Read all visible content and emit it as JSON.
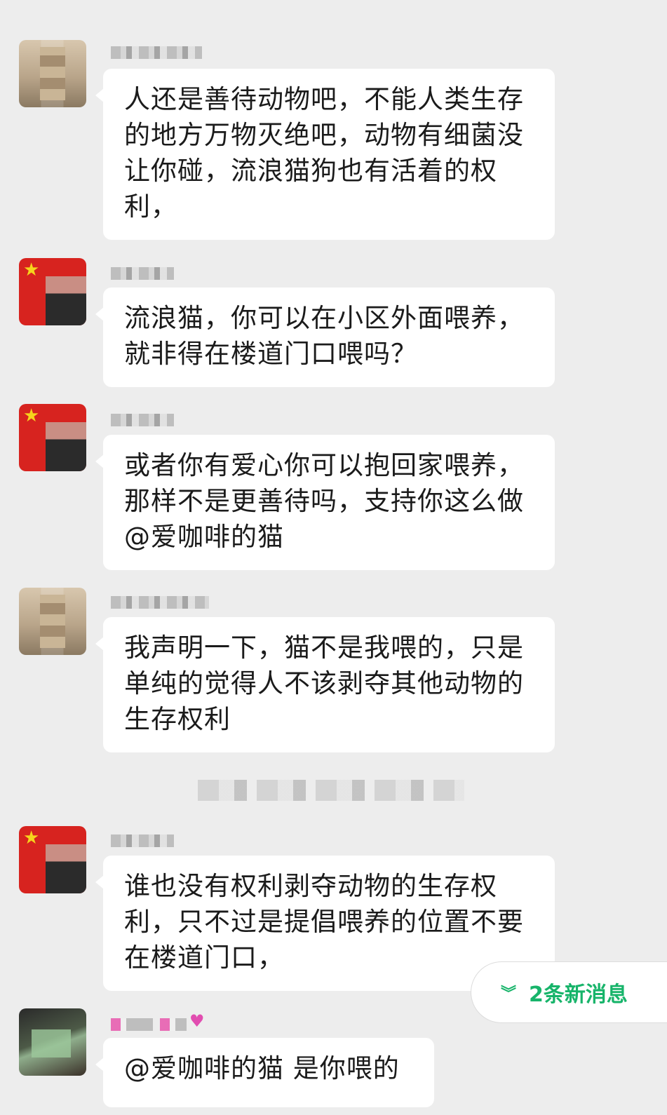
{
  "messages": [
    {
      "text": "人还是善待动物吧，不能人类生存的地方万物灭绝吧，动物有细菌没让你碰，流浪猫狗也有活着的权利，"
    },
    {
      "text": "流浪猫，你可以在小区外面喂养，就非得在楼道门口喂吗？"
    },
    {
      "text": "或者你有爱心你可以抱回家喂养，那样不是更善待吗，支持你这么做@爱咖啡的猫"
    },
    {
      "text": "我声明一下，猫不是我喂的，只是单纯的觉得人不该剥夺其他动物的生存权利"
    },
    {
      "text": "谁也没有权利剥夺动物的生存权利，只不过是提倡喂养的位置不要在楼道门口，"
    },
    {
      "text": "@爱咖啡的猫  是你喂的"
    }
  ],
  "new_messages_pill": {
    "icon": "chevron-double-down-icon",
    "label": "2条新消息"
  },
  "colors": {
    "accent": "#17b46a",
    "background": "#ededed",
    "bubble": "#ffffff"
  }
}
